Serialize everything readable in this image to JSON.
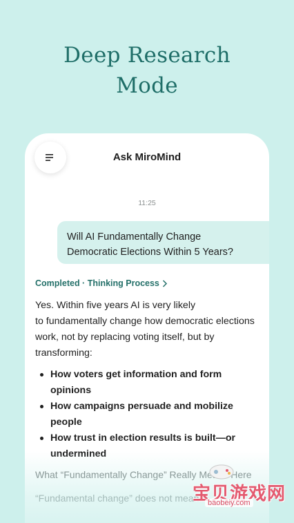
{
  "hero": {
    "line1": "Deep Research",
    "line2": "Mode"
  },
  "header": {
    "title": "Ask MiroMind",
    "menu_icon": "menu-icon"
  },
  "chat": {
    "time": "11:25",
    "user_message": [
      "Will AI Fundamentally Change",
      "Democratic Elections Within 5 Years?"
    ],
    "thinking_label": "Completed · Thinking Process",
    "answer_lines": [
      "Yes. Within five years AI is very likely",
      "to fundamentally change how democratic elections",
      "work, not by replacing voting itself, but by",
      "transforming:"
    ],
    "bullets": [
      [
        "How voters get information and form",
        "opinions"
      ],
      [
        "How campaigns persuade and mobilize",
        "people"
      ],
      [
        "How trust in election results is built—or",
        "undermined"
      ]
    ],
    "faded_heading": "What “Fundamentally Change” Really Means Here",
    "faded_text": "“Fundamental change” does not mean"
  },
  "watermark": {
    "text": "宝贝游戏网",
    "url": "baobeiy.com"
  },
  "colors": {
    "background": "#cdf0ec",
    "accent": "#1f6e68",
    "bubble": "#d5f1ed"
  }
}
